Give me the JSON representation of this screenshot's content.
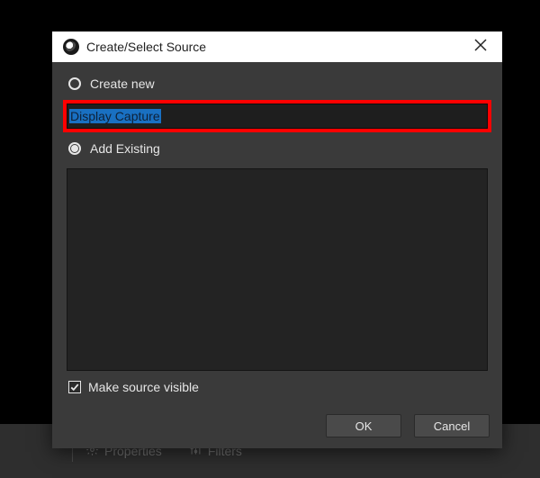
{
  "dialog": {
    "title": "Create/Select Source",
    "create_new_label": "Create new",
    "create_new_selected": true,
    "source_name_value": "Display Capture",
    "add_existing_label": "Add Existing",
    "add_existing_selected": false,
    "make_visible_label": "Make source visible",
    "make_visible_checked": true,
    "ok_label": "OK",
    "cancel_label": "Cancel"
  },
  "background": {
    "properties_label": "Properties",
    "filters_label": "Filters"
  }
}
